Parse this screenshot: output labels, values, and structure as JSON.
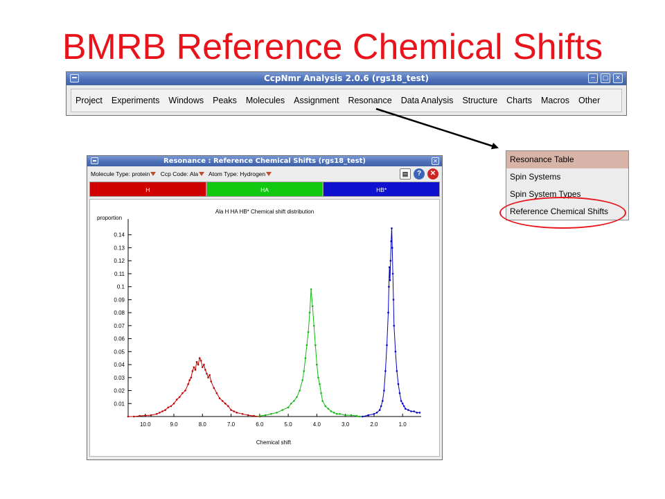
{
  "slide": {
    "title": "BMRB Reference Chemical Shifts"
  },
  "main_window": {
    "title": "CcpNmr Analysis 2.0.6 (rgs18_test)",
    "menu": [
      "Project",
      "Experiments",
      "Windows",
      "Peaks",
      "Molecules",
      "Assignment",
      "Resonance",
      "Data Analysis",
      "Structure",
      "Charts",
      "Macros",
      "Other"
    ]
  },
  "resonance_menu": {
    "items": [
      "Resonance Table",
      "Spin Systems",
      "Spin System Types",
      "Reference Chemical Shifts"
    ],
    "highlighted": "Resonance Table",
    "circled": "Reference Chemical Shifts"
  },
  "resonance_window": {
    "title": "Resonance : Reference Chemical Shifts (rgs18_test)",
    "molecule_type_label": "Molecule Type:",
    "molecule_type_value": "protein",
    "ccp_code_label": "Ccp Code:",
    "ccp_code_value": "Ala",
    "atom_type_label": "Atom Type:",
    "atom_type_value": "Hydrogen",
    "tabs": [
      {
        "label": "H",
        "color": "#d00000"
      },
      {
        "label": "HA",
        "color": "#10c810"
      },
      {
        "label": "HB*",
        "color": "#1010d0"
      }
    ]
  },
  "chart_data": {
    "type": "line",
    "title": "Ala H HA HB*  Chemical shift distribution",
    "xlabel": "Chemical shift",
    "ylabel": "proportion",
    "xlim": [
      10.6,
      0.35
    ],
    "ylim": [
      0,
      0.15
    ],
    "x_reversed": true,
    "xticks": [
      10.0,
      9.0,
      8.0,
      7.0,
      6.0,
      5.0,
      4.0,
      3.0,
      2.0,
      1.0
    ],
    "xtick_labels": [
      "10.0",
      "9.0",
      "8.0",
      "7.0",
      "6.0",
      "5.0",
      "4.0",
      "3.0",
      "2.0",
      "1.0"
    ],
    "yticks": [
      0.01,
      0.02,
      0.03,
      0.04,
      0.05,
      0.06,
      0.07,
      0.08,
      0.09,
      0.1,
      0.11,
      0.12,
      0.13,
      0.14
    ],
    "ytick_labels": [
      "0.01",
      "0.02",
      "0.03",
      "0.04",
      "0.05",
      "0.06",
      "0.07",
      "0.08",
      "0.09",
      "0.1",
      "0.11",
      "0.12",
      "0.13",
      "0.14"
    ],
    "grid": false,
    "series": [
      {
        "color": "#c00000",
        "x": [
          10.6,
          10.4,
          10.2,
          10.0,
          9.8,
          9.6,
          9.5,
          9.4,
          9.3,
          9.2,
          9.1,
          9.0,
          8.9,
          8.8,
          8.7,
          8.6,
          8.5,
          8.45,
          8.4,
          8.35,
          8.3,
          8.25,
          8.2,
          8.15,
          8.1,
          8.05,
          8.0,
          7.95,
          7.9,
          7.85,
          7.8,
          7.75,
          7.7,
          7.6,
          7.5,
          7.4,
          7.3,
          7.2,
          7.1,
          7.0,
          6.9,
          6.8,
          6.6,
          6.4,
          6.2,
          6.0
        ],
        "y": [
          0.0,
          0.0,
          0.0005,
          0.0008,
          0.001,
          0.002,
          0.003,
          0.004,
          0.005,
          0.007,
          0.008,
          0.01,
          0.013,
          0.015,
          0.018,
          0.02,
          0.025,
          0.028,
          0.03,
          0.035,
          0.038,
          0.036,
          0.042,
          0.04,
          0.045,
          0.043,
          0.038,
          0.04,
          0.036,
          0.033,
          0.03,
          0.032,
          0.027,
          0.022,
          0.018,
          0.014,
          0.012,
          0.01,
          0.008,
          0.005,
          0.004,
          0.003,
          0.002,
          0.001,
          0.0005,
          0.0
        ]
      },
      {
        "color": "#10b810",
        "x": [
          6.0,
          5.8,
          5.6,
          5.4,
          5.2,
          5.0,
          4.9,
          4.8,
          4.7,
          4.6,
          4.5,
          4.45,
          4.4,
          4.35,
          4.3,
          4.25,
          4.2,
          4.15,
          4.1,
          4.05,
          4.0,
          3.95,
          3.9,
          3.85,
          3.8,
          3.7,
          3.6,
          3.5,
          3.4,
          3.3,
          3.2,
          3.0,
          2.8,
          2.6,
          2.5
        ],
        "y": [
          0.0005,
          0.001,
          0.002,
          0.003,
          0.005,
          0.007,
          0.01,
          0.012,
          0.015,
          0.02,
          0.028,
          0.035,
          0.045,
          0.055,
          0.065,
          0.08,
          0.098,
          0.085,
          0.07,
          0.055,
          0.04,
          0.03,
          0.025,
          0.018,
          0.012,
          0.008,
          0.006,
          0.004,
          0.003,
          0.002,
          0.002,
          0.001,
          0.001,
          0.0005,
          0.0
        ]
      },
      {
        "color": "#0000c0",
        "x": [
          2.4,
          2.2,
          2.0,
          1.9,
          1.8,
          1.75,
          1.7,
          1.65,
          1.6,
          1.55,
          1.5,
          1.48,
          1.46,
          1.44,
          1.42,
          1.4,
          1.38,
          1.36,
          1.34,
          1.32,
          1.3,
          1.25,
          1.2,
          1.15,
          1.1,
          1.05,
          1.0,
          0.95,
          0.9,
          0.8,
          0.7,
          0.6,
          0.5,
          0.4
        ],
        "y": [
          0.0,
          0.001,
          0.002,
          0.003,
          0.005,
          0.008,
          0.012,
          0.02,
          0.035,
          0.055,
          0.08,
          0.1,
          0.115,
          0.105,
          0.12,
          0.135,
          0.145,
          0.13,
          0.11,
          0.09,
          0.07,
          0.05,
          0.035,
          0.025,
          0.018,
          0.012,
          0.01,
          0.008,
          0.006,
          0.005,
          0.004,
          0.004,
          0.003,
          0.003
        ]
      }
    ]
  }
}
